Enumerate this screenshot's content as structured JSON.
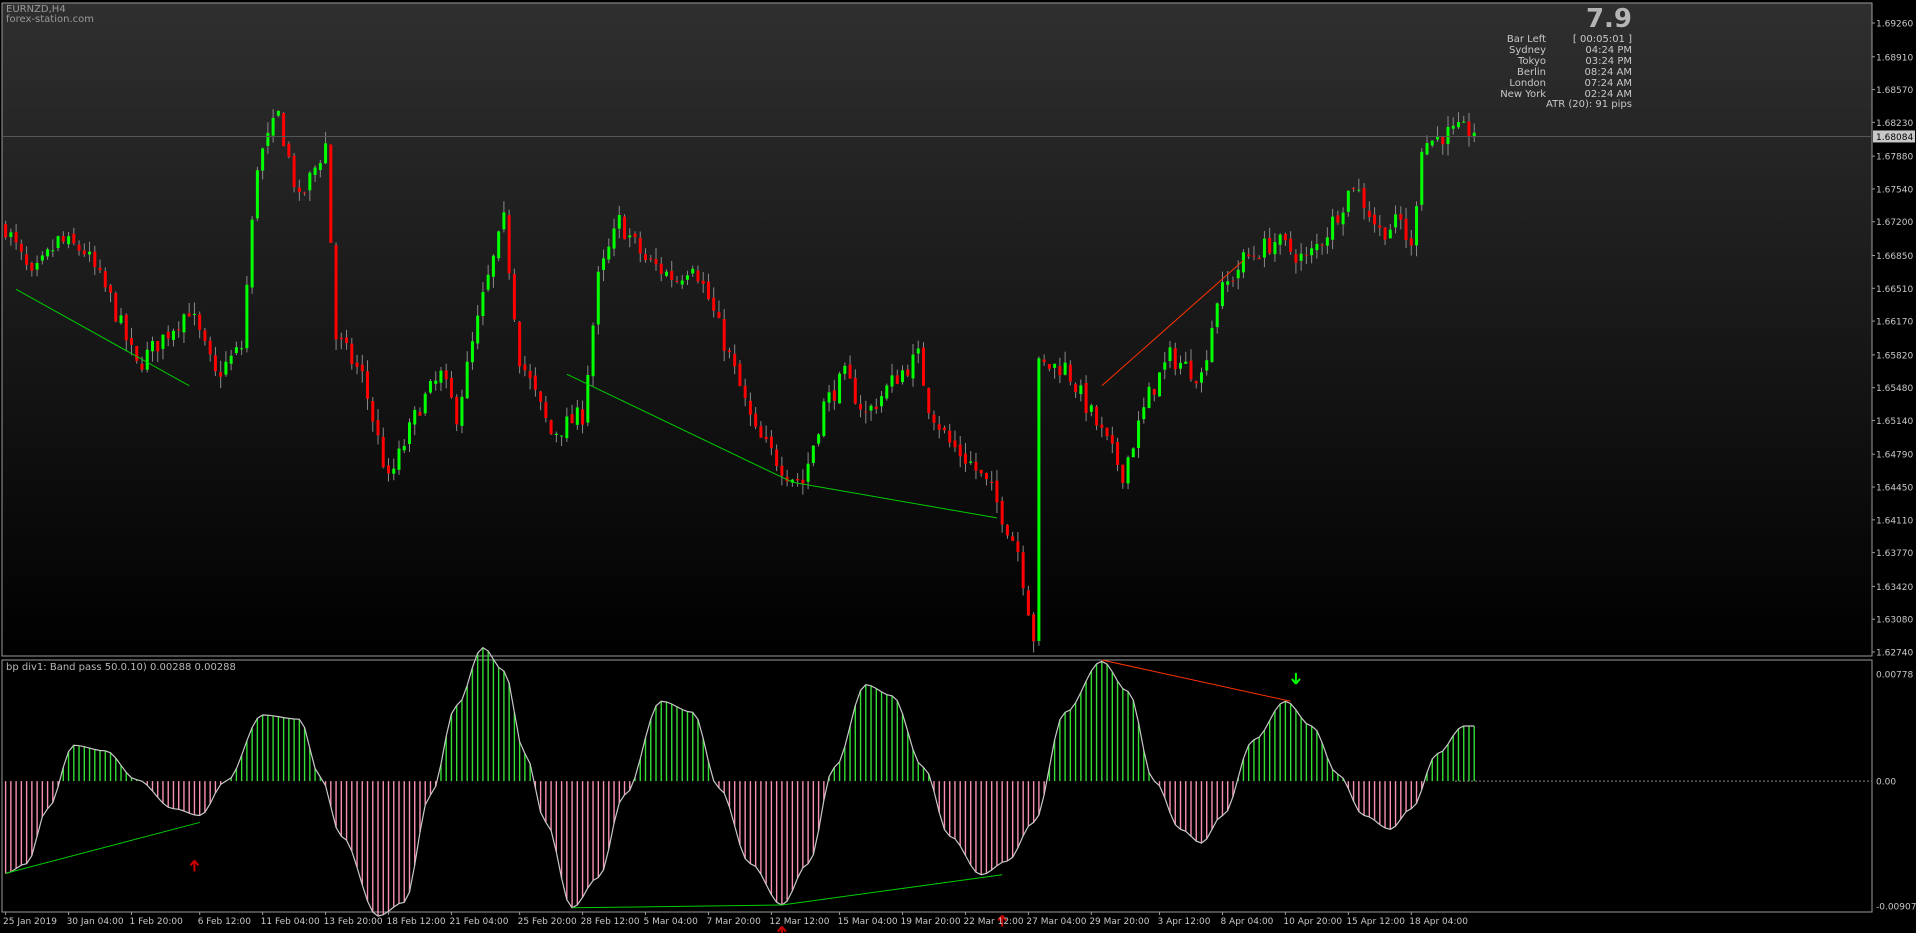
{
  "header": {
    "symbol": "EURNZD,H4",
    "site": "forex-station.com"
  },
  "info_panel": {
    "big_value": "7.9",
    "rows": [
      {
        "label": "Bar Left",
        "value": "[ 00:05:01 ]"
      },
      {
        "label": "Sydney",
        "value": "04:24 PM"
      },
      {
        "label": "Tokyo",
        "value": "03:24 PM"
      },
      {
        "label": "Berlin",
        "value": "08:24 AM"
      },
      {
        "label": "London",
        "value": "07:24 AM"
      },
      {
        "label": "New York",
        "value": "02:24 AM"
      }
    ],
    "atr": "ATR (20): 91 pips"
  },
  "indicator": {
    "label": "bp div1: Band pass 50.0.10) 0.00288 0.00288"
  },
  "colors": {
    "bull": "#00ff00",
    "bear": "#ff0000",
    "hist_pos": "#33dd33",
    "hist_neg": "#f78fb0",
    "wave_line": "#c8c8c8",
    "div_bull": "#00cc00",
    "div_bear": "#ff3300",
    "arrow_up": "#cc0000",
    "arrow_down": "#00ff00",
    "axis_text": "#c8c8c8",
    "current_price_bg": "#c8c8c8"
  },
  "chart_data": [
    {
      "type": "candlestick",
      "title": "EURNZD,H4",
      "xlabel": "",
      "ylabel": "",
      "ylim": [
        1.6274,
        1.6926
      ],
      "y_ticks": [
        "1.69260",
        "1.68910",
        "1.68570",
        "1.68230",
        "1.67880",
        "1.67540",
        "1.67200",
        "1.66850",
        "1.66510",
        "1.66170",
        "1.65820",
        "1.65480",
        "1.65140",
        "1.64790",
        "1.64450",
        "1.64110",
        "1.63770",
        "1.63420",
        "1.63080",
        "1.62740"
      ],
      "current_price": "1.68084",
      "x_tick_labels": [
        "25 Jan 2019",
        "30 Jan 04:00",
        "1 Feb 20:00",
        "6 Feb 12:00",
        "11 Feb 04:00",
        "13 Feb 20:00",
        "18 Feb 12:00",
        "21 Feb 04:00",
        "25 Feb 20:00",
        "28 Feb 12:00",
        "5 Mar 04:00",
        "7 Mar 20:00",
        "12 Mar 12:00",
        "15 Mar 04:00",
        "19 Mar 20:00",
        "22 Mar 12:00",
        "27 Mar 04:00",
        "29 Mar 20:00",
        "3 Apr 12:00",
        "8 Apr 04:00",
        "10 Apr 20:00",
        "15 Apr 12:00",
        "18 Apr 04:00"
      ],
      "close_path": [
        [
          0,
          1.6715
        ],
        [
          5,
          1.666
        ],
        [
          10,
          1.67
        ],
        [
          15,
          1.669
        ],
        [
          20,
          1.664
        ],
        [
          25,
          1.657
        ],
        [
          30,
          1.66
        ],
        [
          35,
          1.663
        ],
        [
          40,
          1.656
        ],
        [
          45,
          1.659
        ],
        [
          48,
          1.678
        ],
        [
          52,
          1.683
        ],
        [
          56,
          1.674
        ],
        [
          61,
          1.68
        ],
        [
          63,
          1.66
        ],
        [
          68,
          1.656
        ],
        [
          73,
          1.645
        ],
        [
          79,
          1.653
        ],
        [
          83,
          1.656
        ],
        [
          86,
          1.652
        ],
        [
          91,
          1.664
        ],
        [
          95,
          1.672
        ],
        [
          98,
          1.658
        ],
        [
          104,
          1.65
        ],
        [
          110,
          1.652
        ],
        [
          113,
          1.666
        ],
        [
          117,
          1.672
        ],
        [
          122,
          1.668
        ],
        [
          128,
          1.666
        ],
        [
          131,
          1.668
        ],
        [
          134,
          1.664
        ],
        [
          138,
          1.658
        ],
        [
          143,
          1.65
        ],
        [
          149,
          1.646
        ],
        [
          152,
          1.645
        ],
        [
          156,
          1.653
        ],
        [
          160,
          1.656
        ],
        [
          164,
          1.652
        ],
        [
          170,
          1.656
        ],
        [
          174,
          1.658
        ],
        [
          176,
          1.653
        ],
        [
          180,
          1.649
        ],
        [
          184,
          1.647
        ],
        [
          188,
          1.644
        ],
        [
          193,
          1.638
        ],
        [
          196,
          1.629
        ],
        [
          197,
          1.657
        ],
        [
          202,
          1.657
        ],
        [
          206,
          1.653
        ],
        [
          210,
          1.649
        ],
        [
          213,
          1.646
        ],
        [
          218,
          1.654
        ],
        [
          222,
          1.658
        ],
        [
          228,
          1.656
        ],
        [
          231,
          1.664
        ],
        [
          236,
          1.668
        ],
        [
          242,
          1.67
        ],
        [
          248,
          1.668
        ],
        [
          252,
          1.671
        ],
        [
          257,
          1.676
        ],
        [
          262,
          1.671
        ],
        [
          266,
          1.672
        ],
        [
          268,
          1.669
        ],
        [
          270,
          1.68
        ],
        [
          274,
          1.681
        ],
        [
          280,
          1.6815
        ]
      ],
      "candle_count": 281,
      "divergence_lines": [
        {
          "from": [
            2,
            1.665
          ],
          "to": [
            35,
            1.655
          ],
          "color": "bull"
        },
        {
          "from": [
            107,
            1.6562
          ],
          "to": [
            150,
            1.645
          ],
          "color": "bull"
        },
        {
          "from": [
            150,
            1.645
          ],
          "to": [
            189,
            1.6413
          ],
          "color": "bull"
        },
        {
          "from": [
            209,
            1.655
          ],
          "to": [
            236,
            1.668
          ],
          "color": "bear"
        }
      ]
    },
    {
      "type": "histogram",
      "title": "bp div1: Band pass 50.0.10) 0.00288 0.00288",
      "ylim": [
        -0.00907,
        0.00778
      ],
      "y_ticks": [
        "0.00778",
        "0.00",
        "-0.00907"
      ],
      "wave_points": [
        [
          0,
          -0.0067
        ],
        [
          4,
          -0.006
        ],
        [
          8,
          -0.002
        ],
        [
          13,
          0.0026
        ],
        [
          19,
          0.0022
        ],
        [
          25,
          0.0001
        ],
        [
          32,
          -0.002
        ],
        [
          37,
          -0.0025
        ],
        [
          42,
          0.0
        ],
        [
          49,
          0.0048
        ],
        [
          56,
          0.0045
        ],
        [
          60,
          0.0003
        ],
        [
          64,
          -0.004
        ],
        [
          71,
          -0.0098
        ],
        [
          76,
          -0.0088
        ],
        [
          81,
          -0.001
        ],
        [
          86,
          0.0055
        ],
        [
          91,
          0.0097
        ],
        [
          95,
          0.008
        ],
        [
          99,
          0.002
        ],
        [
          103,
          -0.003
        ],
        [
          108,
          -0.0092
        ],
        [
          113,
          -0.007
        ],
        [
          118,
          -0.001
        ],
        [
          125,
          0.0058
        ],
        [
          131,
          0.005
        ],
        [
          136,
          -0.0005
        ],
        [
          142,
          -0.006
        ],
        [
          148,
          -0.009
        ],
        [
          153,
          -0.006
        ],
        [
          158,
          0.001
        ],
        [
          164,
          0.007
        ],
        [
          169,
          0.0062
        ],
        [
          175,
          0.001
        ],
        [
          180,
          -0.004
        ],
        [
          186,
          -0.0068
        ],
        [
          191,
          -0.0058
        ],
        [
          196,
          -0.003
        ],
        [
          202,
          0.005
        ],
        [
          209,
          0.0087
        ],
        [
          214,
          0.0065
        ],
        [
          219,
          0.0
        ],
        [
          224,
          -0.0035
        ],
        [
          228,
          -0.0045
        ],
        [
          232,
          -0.0025
        ],
        [
          238,
          0.003
        ],
        [
          244,
          0.0058
        ],
        [
          249,
          0.004
        ],
        [
          254,
          0.0005
        ],
        [
          259,
          -0.0025
        ],
        [
          264,
          -0.0035
        ],
        [
          268,
          -0.002
        ],
        [
          273,
          0.002
        ],
        [
          278,
          0.004
        ],
        [
          280,
          0.004
        ]
      ],
      "divergence_lines": [
        {
          "from": [
            0,
            -0.0067
          ],
          "to": [
            37,
            -0.003
          ],
          "color": "bull"
        },
        {
          "from": [
            108,
            -0.0092
          ],
          "to": [
            148,
            -0.009
          ],
          "color": "bull"
        },
        {
          "from": [
            148,
            -0.009
          ],
          "to": [
            190,
            -0.0068
          ],
          "color": "bull"
        },
        {
          "from": [
            209,
            0.0088
          ],
          "to": [
            245,
            0.0058
          ],
          "color": "bear"
        }
      ],
      "signals": [
        {
          "bar": 36,
          "type": "up"
        },
        {
          "bar": 148,
          "type": "up"
        },
        {
          "bar": 190,
          "type": "up"
        },
        {
          "bar": 246,
          "type": "down"
        }
      ]
    }
  ]
}
